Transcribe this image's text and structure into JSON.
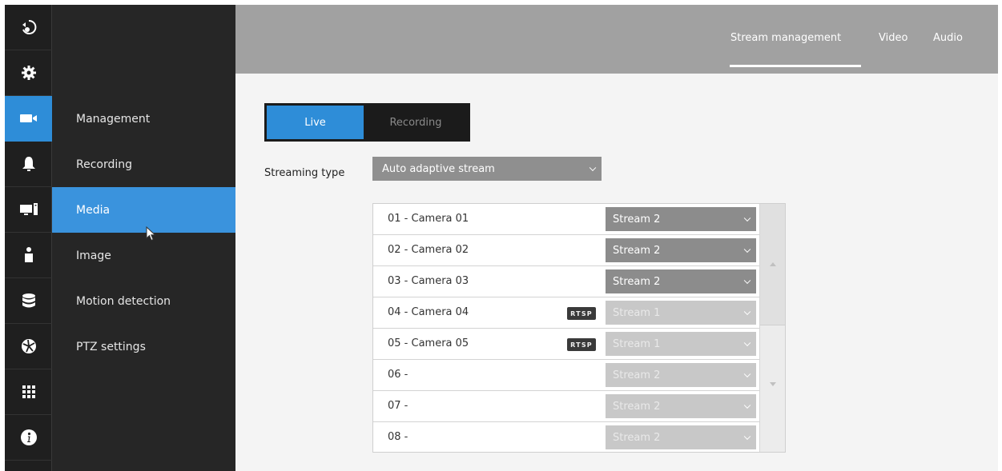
{
  "rail": {
    "items": [
      {
        "name": "back-icon",
        "active": false
      },
      {
        "name": "gear-icon",
        "active": false
      },
      {
        "name": "camera-icon",
        "active": true
      },
      {
        "name": "bell-icon",
        "active": false
      },
      {
        "name": "monitor-icon",
        "active": false
      },
      {
        "name": "user-icon",
        "active": false
      },
      {
        "name": "database-icon",
        "active": false
      },
      {
        "name": "network-icon",
        "active": false
      },
      {
        "name": "grid-icon",
        "active": false
      },
      {
        "name": "info-icon",
        "active": false
      }
    ]
  },
  "submenu": {
    "items": [
      {
        "label": "Management",
        "active": false
      },
      {
        "label": "Recording",
        "active": false
      },
      {
        "label": "Media",
        "active": true
      },
      {
        "label": "Image",
        "active": false
      },
      {
        "label": "Motion detection",
        "active": false
      },
      {
        "label": "PTZ settings",
        "active": false
      }
    ]
  },
  "topbar": {
    "tabs": [
      {
        "label": "Stream management",
        "active": true
      },
      {
        "label": "Video",
        "active": false
      },
      {
        "label": "Audio",
        "active": false
      }
    ]
  },
  "mode": {
    "options": [
      "Live",
      "Recording"
    ],
    "selected": "Live"
  },
  "streaming_type": {
    "label": "Streaming type",
    "value": "Auto adaptive stream"
  },
  "cameras": [
    {
      "name": "01 - Camera 01",
      "stream": "Stream 2",
      "rtsp": "",
      "enabled": true
    },
    {
      "name": "02 - Camera 02",
      "stream": "Stream 2",
      "rtsp": "",
      "enabled": true
    },
    {
      "name": "03 - Camera 03",
      "stream": "Stream 2",
      "rtsp": "",
      "enabled": true
    },
    {
      "name": "04 - Camera 04",
      "stream": "Stream 1",
      "rtsp": "RTSP",
      "enabled": false
    },
    {
      "name": "05 - Camera 05",
      "stream": "Stream 1",
      "rtsp": "RTSP",
      "enabled": false
    },
    {
      "name": "06 -",
      "stream": "Stream 2",
      "rtsp": "",
      "enabled": false
    },
    {
      "name": "07 -",
      "stream": "Stream 2",
      "rtsp": "",
      "enabled": false
    },
    {
      "name": "08 -",
      "stream": "Stream 2",
      "rtsp": "",
      "enabled": false
    }
  ],
  "colors": {
    "accent": "#2e8dd8",
    "rail_bg": "#1f1f1f",
    "submenu_bg": "#262626",
    "topbar_bg": "#a1a1a1"
  }
}
